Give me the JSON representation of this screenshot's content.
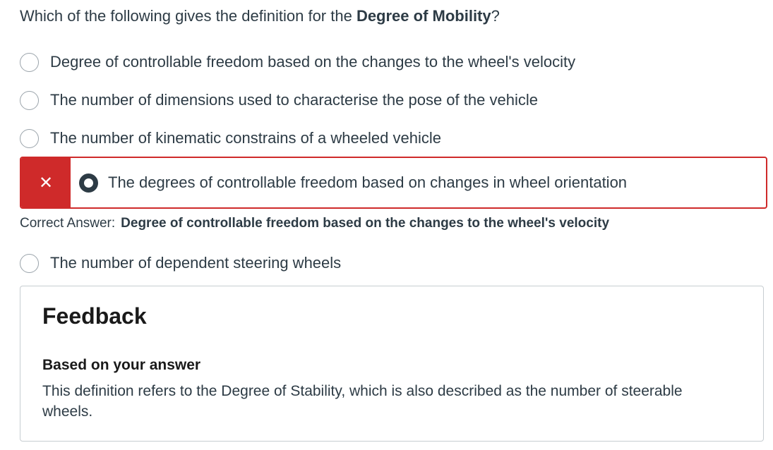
{
  "question": {
    "prefix": "Which of the following gives the definition for the ",
    "term": "Degree of Mobility",
    "suffix": "?"
  },
  "options": [
    {
      "label": "Degree of controllable freedom based on the changes to the wheel's velocity",
      "selected": false
    },
    {
      "label": "The number of dimensions used to characterise the pose of the vehicle",
      "selected": false
    },
    {
      "label": "The number of kinematic constrains of a wheeled vehicle",
      "selected": false
    },
    {
      "label": "The degrees of controllable freedom based on changes in wheel orientation",
      "selected": true,
      "result": "incorrect"
    },
    {
      "label": "The number of dependent steering wheels",
      "selected": false
    }
  ],
  "wrong_marker": "✕",
  "correct_answer": {
    "label": "Correct Answer:",
    "value": "Degree of controllable freedom based on the changes to the wheel's velocity"
  },
  "feedback": {
    "title": "Feedback",
    "subtitle": "Based on your answer",
    "body": "This definition refers to the Degree of Stability, which is also described as the number of steerable wheels."
  },
  "colors": {
    "error": "#cf2a2a",
    "text": "#2d3b45",
    "border": "#c7cdd1"
  }
}
